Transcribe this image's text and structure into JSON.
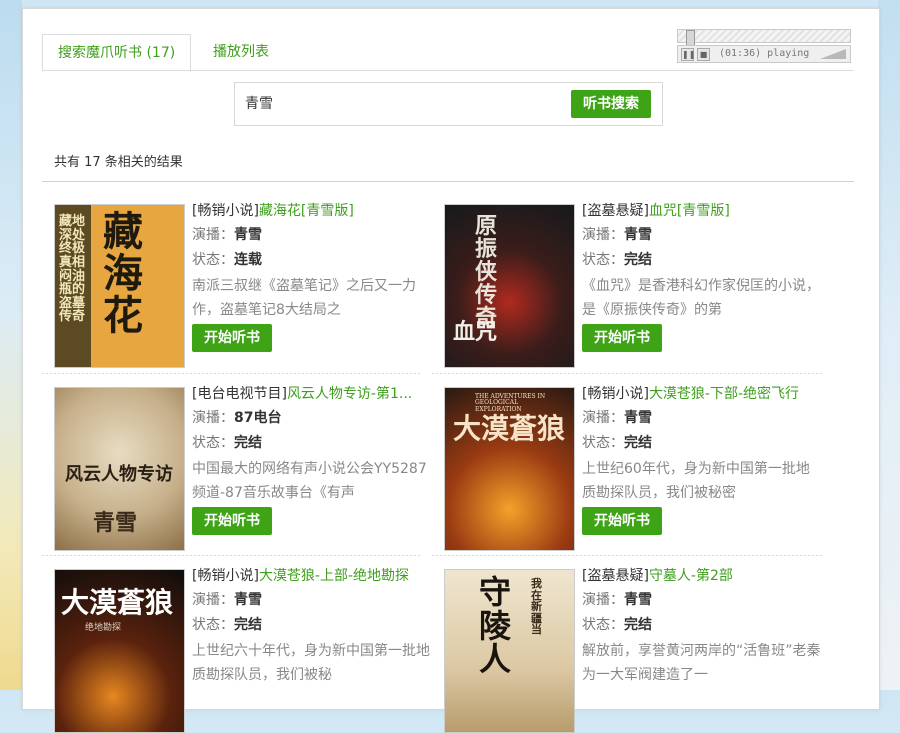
{
  "tabs": [
    {
      "label": "搜索魔爪听书 (17)",
      "active": true
    },
    {
      "label": "播放列表",
      "active": false
    }
  ],
  "player": {
    "status": "(01:36) playing",
    "progress": 0.05
  },
  "search": {
    "query": "青雪",
    "button": "听书搜索"
  },
  "results": {
    "count_text": "共有 17  条相关的结果",
    "listen_label": "开始听书",
    "narrator_label": "演播：",
    "status_label": "状态：",
    "items": [
      {
        "category": "[畅销小说]",
        "name": "藏海花[青雪版]",
        "narrator": "青雪",
        "status": "连载",
        "desc": "南派三叔继《盗墓笔记》之后又一力作，盗墓笔记8大结局之",
        "cover_text": "藏海花",
        "cover_sub": "藏地深处终极真相 闷油瓶的盗墓传奇"
      },
      {
        "category": "[盗墓悬疑]",
        "name": "血咒[青雪版]",
        "narrator": "青雪",
        "status": "完结",
        "desc": "《血咒》是香港科幻作家倪匡的小说，是《原振侠传奇》的第",
        "cover_text": "原振侠传奇",
        "cover_sub": "血咒"
      },
      {
        "category": "[电台电视节目]",
        "name": "风云人物专访-第1...",
        "narrator": "87电台",
        "status": "完结",
        "desc": "中国最大的网络有声小说公会YY5287频道-87音乐故事台《有声",
        "cover_text": "风云人物专访",
        "cover_sub": "青雪"
      },
      {
        "category": "[畅销小说]",
        "name": "大漠苍狼-下部-绝密飞行",
        "narrator": "青雪",
        "status": "完结",
        "desc": "上世纪60年代，身为新中国第一批地质勘探队员，我们被秘密",
        "cover_text": "大漠蒼狼",
        "cover_sub": "THE ADVENTURES IN GEOLOGICAL EXPLORATION"
      },
      {
        "category": "[畅销小说]",
        "name": "大漠苍狼-上部-绝地勘探",
        "narrator": "青雪",
        "status": "完结",
        "desc": "上世纪六十年代，身为新中国第一批地质勘探队员，我们被秘",
        "cover_text": "大漠蒼狼",
        "cover_sub": "绝地勘探"
      },
      {
        "category": "[盗墓悬疑]",
        "name": "守墓人-第2部",
        "narrator": "青雪",
        "status": "完结",
        "desc": "解放前，享誉黄河两岸的“活鲁班”老秦为一大军阀建造了一",
        "cover_text": "守陵人",
        "cover_sub": "我在新疆当"
      }
    ]
  },
  "colors": {
    "accent": "#3fa316",
    "link": "#3f9f1c"
  }
}
